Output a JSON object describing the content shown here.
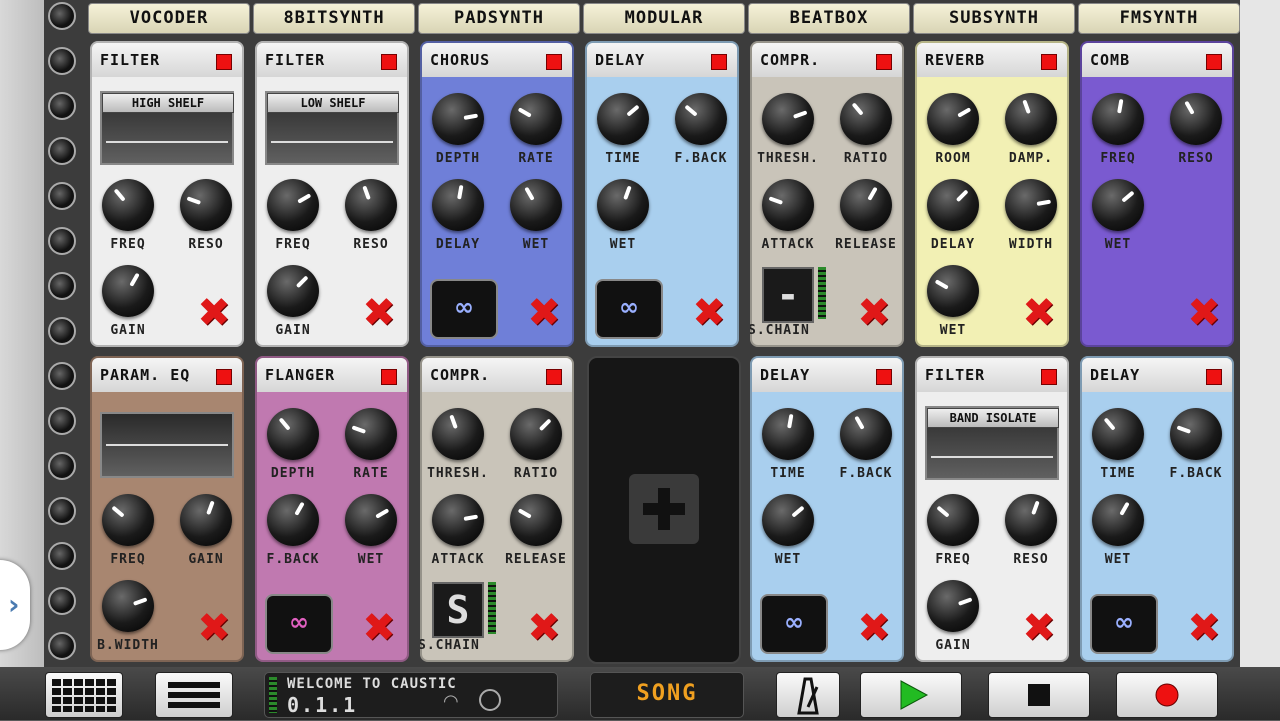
{
  "tabs": [
    "VOCODER",
    "8BITSYNTH",
    "PADSYNTH",
    "MODULAR",
    "BEATBOX",
    "SUBSYNTH",
    "FMSYNTH"
  ],
  "units": [
    {
      "title": "FILTER",
      "bg": "#eeeeee",
      "graph_label": "HIGH SHELF",
      "knobs": [
        "FREQ",
        "RESO",
        "GAIN"
      ]
    },
    {
      "title": "FILTER",
      "bg": "#eeeeee",
      "graph_label": "LOW SHELF",
      "knobs": [
        "FREQ",
        "RESO",
        "GAIN"
      ]
    },
    {
      "title": "CHORUS",
      "bg": "#6f7fd8",
      "knobs": [
        "DEPTH",
        "RATE",
        "DELAY",
        "WET"
      ]
    },
    {
      "title": "DELAY",
      "bg": "#a9cfee",
      "knobs": [
        "TIME",
        "F.BACK",
        "WET"
      ]
    },
    {
      "title": "COMPR.",
      "bg": "#c9c4b9",
      "knobs": [
        "THRESH.",
        "RATIO",
        "ATTACK",
        "RELEASE"
      ],
      "lcd": "-",
      "sub": "S.CHAIN"
    },
    {
      "title": "REVERB",
      "bg": "#f2f0b4",
      "knobs": [
        "ROOM",
        "DAMP.",
        "DELAY",
        "WIDTH",
        "WET"
      ]
    },
    {
      "title": "COMB",
      "bg": "#7a5ad0",
      "knobs": [
        "FREQ",
        "RESO",
        "WET"
      ]
    },
    {
      "title": "PARAM. EQ",
      "bg": "#a88670",
      "knobs": [
        "FREQ",
        "GAIN",
        "B.WIDTH"
      ]
    },
    {
      "title": "FLANGER",
      "bg": "#c079b0",
      "knobs": [
        "DEPTH",
        "RATE",
        "F.BACK",
        "WET"
      ]
    },
    {
      "title": "COMPR.",
      "bg": "#c9c4b9",
      "knobs": [
        "THRESH.",
        "RATIO",
        "ATTACK",
        "RELEASE"
      ],
      "lcd": "S",
      "sub": "S.CHAIN"
    },
    {
      "title": "DELAY",
      "bg": "#a9cfee",
      "knobs": [
        "TIME",
        "F.BACK",
        "WET"
      ]
    },
    {
      "title": "FILTER",
      "bg": "#eeeeee",
      "graph_label": "BAND ISOLATE",
      "knobs": [
        "FREQ",
        "RESO",
        "GAIN"
      ]
    },
    {
      "title": "DELAY",
      "bg": "#a9cfee",
      "knobs": [
        "TIME",
        "F.BACK",
        "WET"
      ]
    }
  ],
  "status": {
    "line1": "WELCOME TO CAUSTIC",
    "line2": "0.1.1"
  },
  "song_label": "SONG",
  "colors": {
    "accent": "#f0a020",
    "led": "#ee1111",
    "play": "#22bb22",
    "record": "#ee1111"
  }
}
